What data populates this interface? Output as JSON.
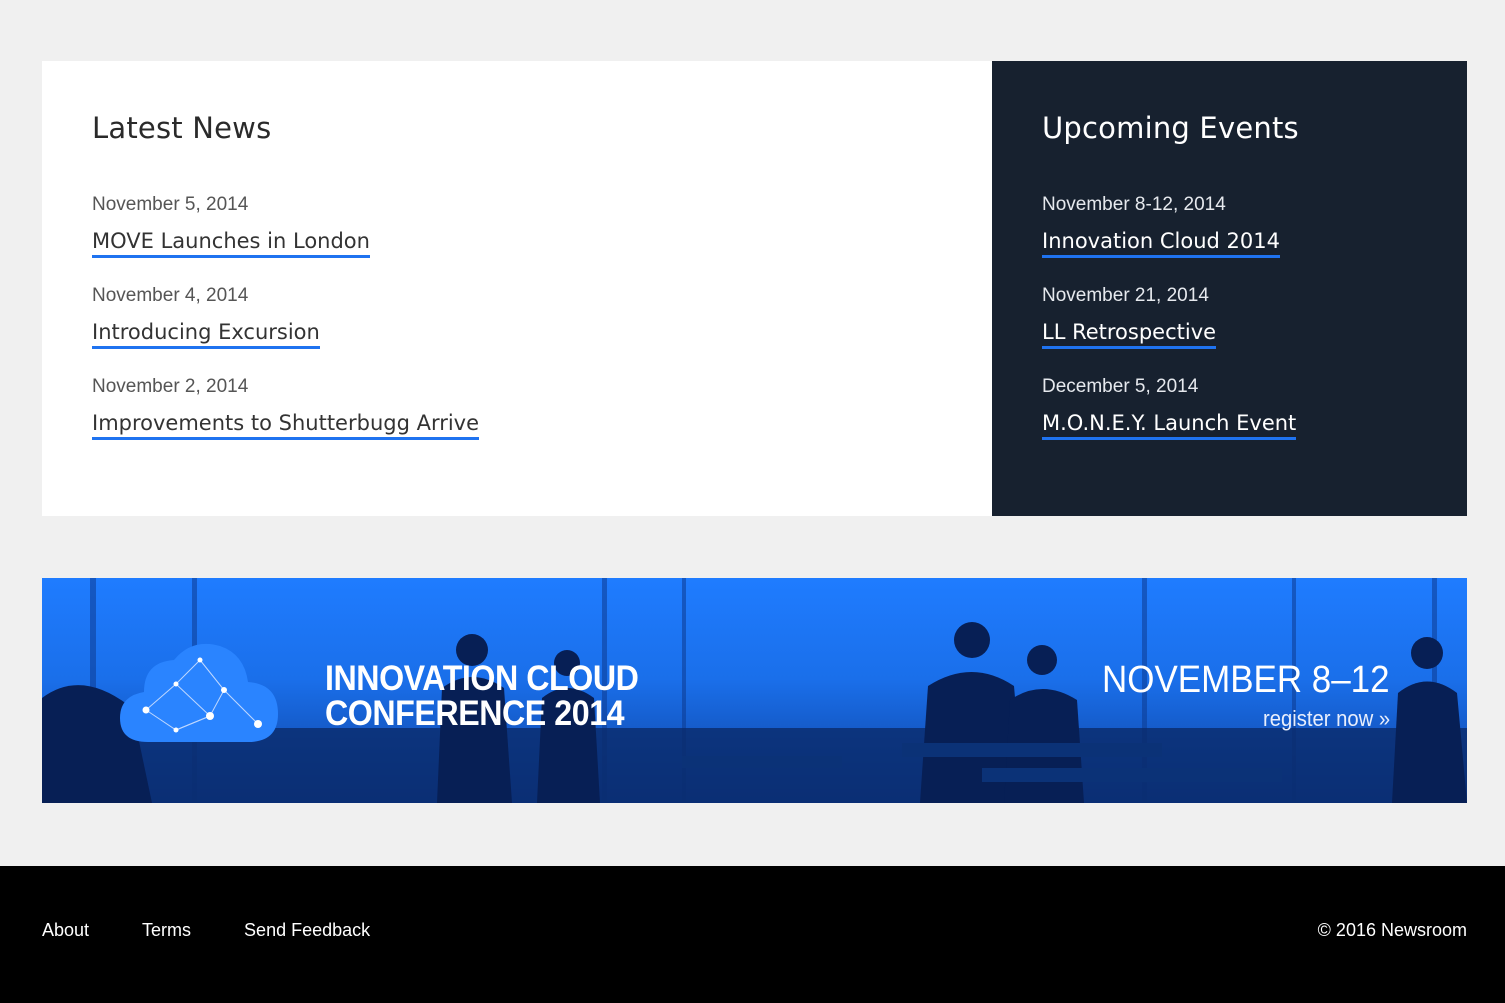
{
  "news": {
    "title": "Latest News",
    "items": [
      {
        "date": "November 5, 2014",
        "title": "MOVE Launches in London"
      },
      {
        "date": "November 4, 2014",
        "title": "Introducing Excursion"
      },
      {
        "date": "November 2, 2014",
        "title": "Improvements to Shutterbugg Arrive"
      }
    ]
  },
  "events": {
    "title": "Upcoming Events",
    "items": [
      {
        "date": "November 8-12, 2014",
        "title": "Innovation Cloud 2014"
      },
      {
        "date": "November 21, 2014",
        "title": "LL Retrospective"
      },
      {
        "date": "December 5, 2014",
        "title": "M.O.N.E.Y. Launch Event"
      }
    ]
  },
  "banner": {
    "title_line1": "INNOVATION CLOUD",
    "title_line2": "CONFERENCE 2014",
    "dates": "NOVEMBER 8–12",
    "cta": "register now »",
    "logo_icon": "cloud-network-icon"
  },
  "footer": {
    "links": [
      "About",
      "Terms",
      "Send Feedback"
    ],
    "copyright": "© 2016 Newsroom"
  },
  "colors": {
    "accent": "#1f73f0",
    "events_bg": "#17212f",
    "page_bg": "#f0f0f0",
    "banner_blue": "#1a6fea",
    "footer_bg": "#000000"
  }
}
